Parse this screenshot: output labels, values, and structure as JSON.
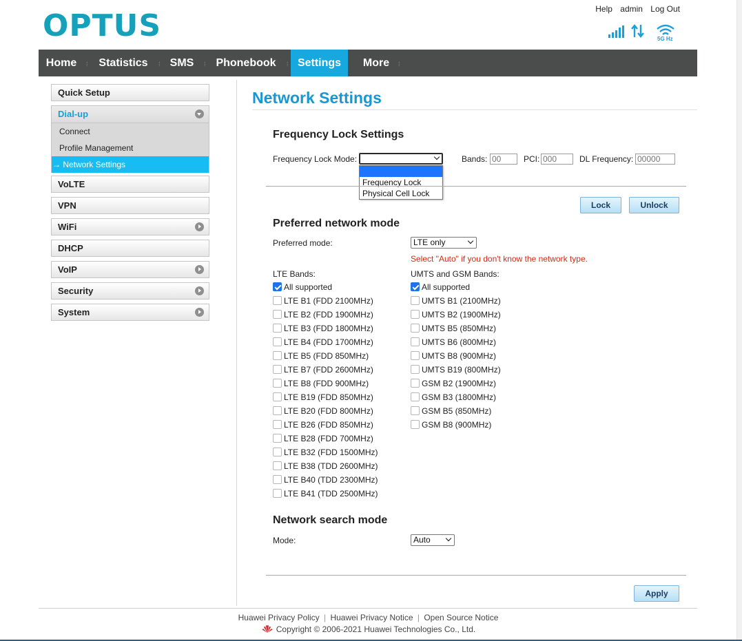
{
  "brand": {
    "logo_text": "OPTUS",
    "logo_color": "#16a1bb",
    "accent": "#16a8df"
  },
  "top_links": {
    "help": "Help",
    "user": "admin",
    "logout": "Log Out"
  },
  "status": {
    "signal_icon": "signal-bars-icon",
    "data_icon": "data-transfer-icon",
    "wifi_icon": "wifi-icon",
    "wifi_band": "5G Hz"
  },
  "nav": {
    "home": "Home",
    "statistics": "Statistics",
    "sms": "SMS",
    "phonebook": "Phonebook",
    "settings": "Settings",
    "more": "More",
    "active": "Settings"
  },
  "sidebar": {
    "quick_setup": "Quick Setup",
    "dialup": "Dial-up",
    "connect": "Connect",
    "profile_management": "Profile Management",
    "network_settings": "→ Network Settings",
    "volte": "VoLTE",
    "vpn": "VPN",
    "wifi": "WiFi",
    "dhcp": "DHCP",
    "voip": "VoIP",
    "security": "Security",
    "system": "System"
  },
  "page": {
    "title": "Network Settings"
  },
  "freq_lock": {
    "title": "Frequency Lock Settings",
    "mode_label": "Frequency Lock Mode:",
    "mode_value": "",
    "options": [
      "",
      "Frequency Lock",
      "Physical Cell Lock"
    ],
    "bands_label": "Bands:",
    "bands_placeholder": "00",
    "pci_label": "PCI:",
    "pci_placeholder": "000",
    "dl_label": "DL Frequency:",
    "dl_placeholder": "00000",
    "lock_button": "Lock",
    "unlock_button": "Unlock"
  },
  "preferred": {
    "title": "Preferred network mode",
    "mode_label": "Preferred mode:",
    "mode_value": "LTE only",
    "warning": "Select \"Auto\" if you don't know the network type.",
    "lte_label": "LTE Bands:",
    "umts_label": "UMTS and GSM Bands:",
    "lte_bands": [
      {
        "label": "All supported",
        "checked": true
      },
      {
        "label": "LTE B1 (FDD 2100MHz)",
        "checked": false
      },
      {
        "label": "LTE B2 (FDD 1900MHz)",
        "checked": false
      },
      {
        "label": "LTE B3 (FDD 1800MHz)",
        "checked": false
      },
      {
        "label": "LTE B4 (FDD 1700MHz)",
        "checked": false
      },
      {
        "label": "LTE B5 (FDD 850MHz)",
        "checked": false
      },
      {
        "label": "LTE B7 (FDD 2600MHz)",
        "checked": false
      },
      {
        "label": "LTE B8 (FDD 900MHz)",
        "checked": false
      },
      {
        "label": "LTE B19 (FDD 850MHz)",
        "checked": false
      },
      {
        "label": "LTE B20 (FDD 800MHz)",
        "checked": false
      },
      {
        "label": "LTE B26 (FDD 850MHz)",
        "checked": false
      },
      {
        "label": "LTE B28 (FDD 700MHz)",
        "checked": false
      },
      {
        "label": "LTE B32 (FDD 1500MHz)",
        "checked": false
      },
      {
        "label": "LTE B38 (TDD 2600MHz)",
        "checked": false
      },
      {
        "label": "LTE B40 (TDD 2300MHz)",
        "checked": false
      },
      {
        "label": "LTE B41 (TDD 2500MHz)",
        "checked": false
      }
    ],
    "umts_bands": [
      {
        "label": "All supported",
        "checked": true
      },
      {
        "label": "UMTS B1 (2100MHz)",
        "checked": false
      },
      {
        "label": "UMTS B2 (1900MHz)",
        "checked": false
      },
      {
        "label": "UMTS B5 (850MHz)",
        "checked": false
      },
      {
        "label": "UMTS B6 (800MHz)",
        "checked": false
      },
      {
        "label": "UMTS B8 (900MHz)",
        "checked": false
      },
      {
        "label": "UMTS B19 (800MHz)",
        "checked": false
      },
      {
        "label": "GSM B2 (1900MHz)",
        "checked": false
      },
      {
        "label": "GSM B3 (1800MHz)",
        "checked": false
      },
      {
        "label": "GSM B5 (850MHz)",
        "checked": false
      },
      {
        "label": "GSM B8 (900MHz)",
        "checked": false
      }
    ]
  },
  "search": {
    "title": "Network search mode",
    "mode_label": "Mode:",
    "mode_value": "Auto",
    "apply_button": "Apply"
  },
  "footer": {
    "privacy_policy": "Huawei Privacy Policy",
    "privacy_notice": "Huawei Privacy Notice",
    "open_source": "Open Source Notice",
    "separator": "|",
    "copyright": "Copyright © 2006-2021 Huawei Technologies Co., Ltd."
  }
}
